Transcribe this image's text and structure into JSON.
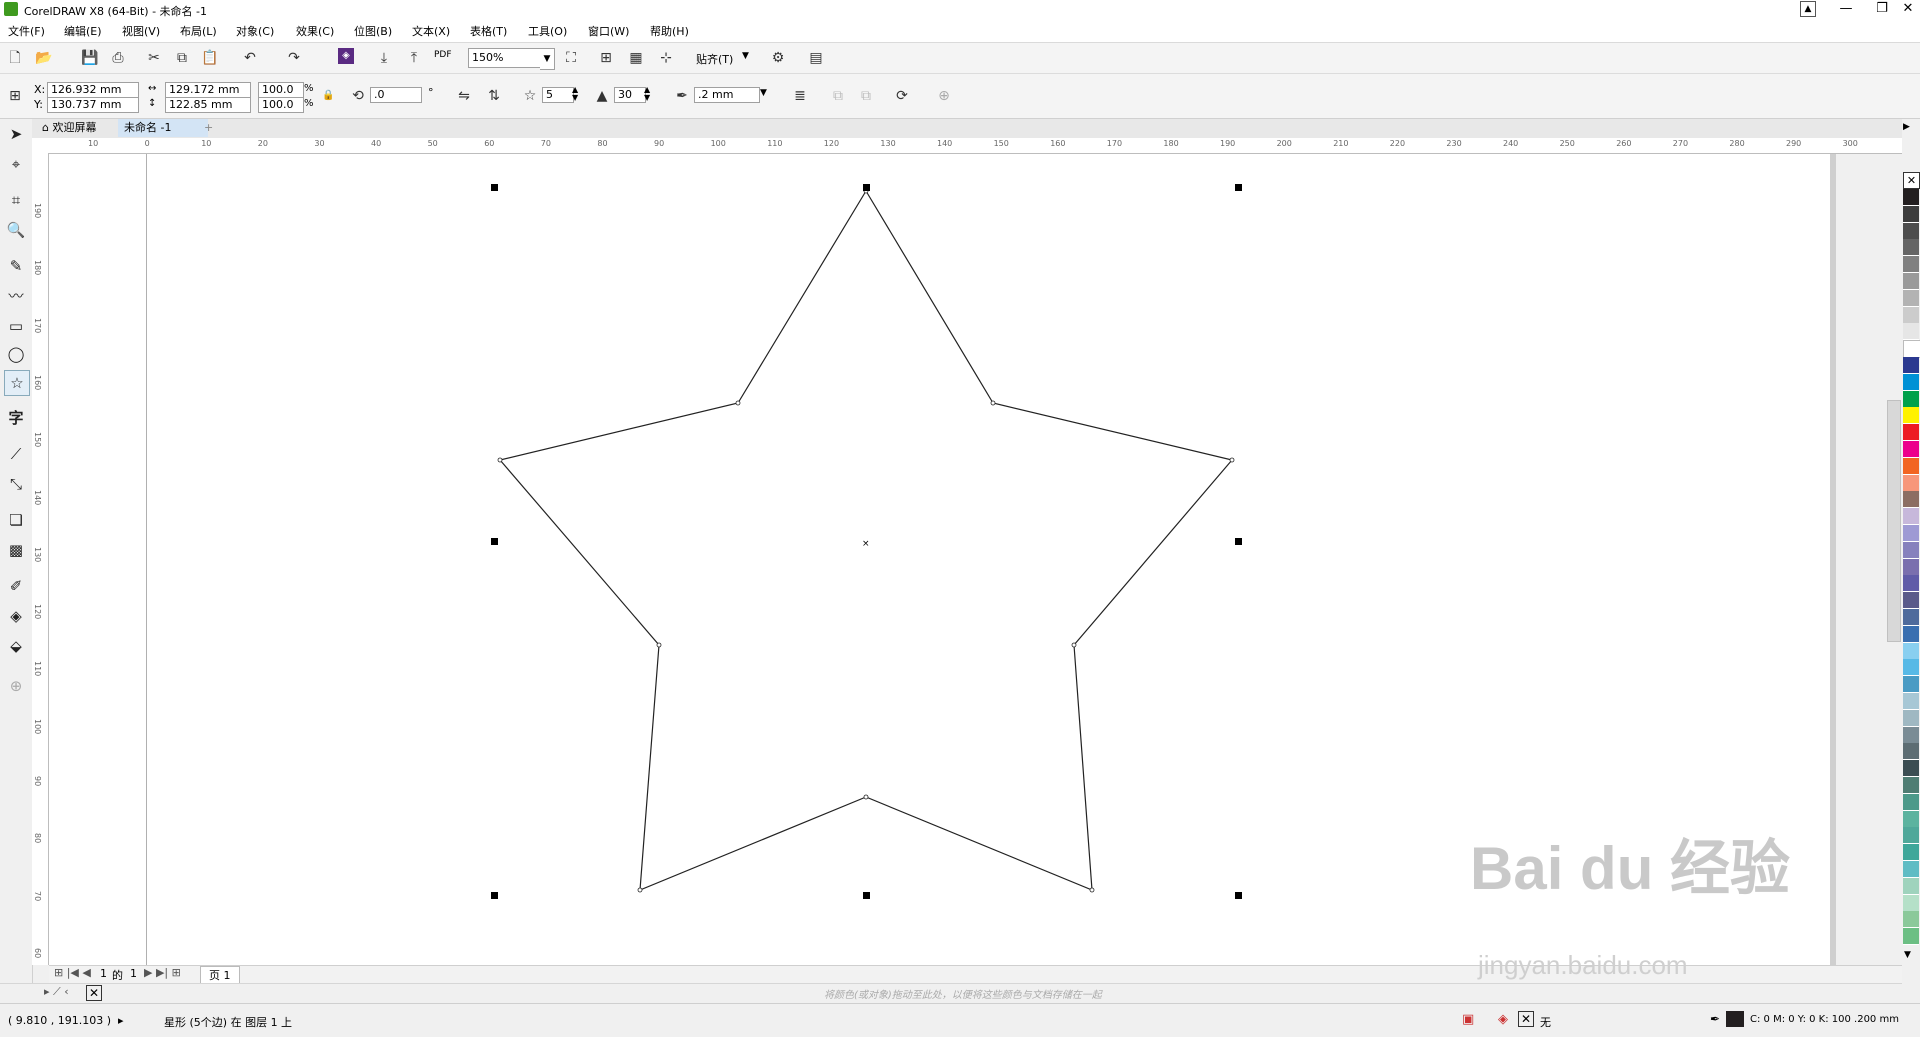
{
  "window": {
    "title": "CorelDRAW X8 (64-Bit) - 未命名 -1",
    "minimize": "—",
    "maximize": "❐",
    "close": "✕"
  },
  "menu": [
    "文件(F)",
    "编辑(E)",
    "视图(V)",
    "布局(L)",
    "对象(C)",
    "效果(C)",
    "位图(B)",
    "文本(X)",
    "表格(T)",
    "工具(O)",
    "窗口(W)",
    "帮助(H)"
  ],
  "toolbar": {
    "zoom": "150%",
    "snap_label": "贴齐(T)",
    "pdf_label": "PDF"
  },
  "props": {
    "x": "126.932 mm",
    "y": "130.737 mm",
    "width": "129.172 mm",
    "height": "122.85 mm",
    "scale_w": "100.0",
    "scale_h": "100.0",
    "percent": "%",
    "rotation": ".0",
    "degree": "°",
    "points": "5",
    "sharpness": "30",
    "outline": ".2 mm"
  },
  "tabs": {
    "welcome": "欢迎屏幕",
    "doc": "未命名 -1",
    "add": "+"
  },
  "ruler": {
    "h_labels": [
      "10",
      "0",
      "10",
      "20",
      "30",
      "40",
      "50",
      "60",
      "70",
      "80",
      "90",
      "100",
      "110",
      "120",
      "130",
      "140",
      "150",
      "160",
      "170",
      "180",
      "190",
      "200",
      "210",
      "220",
      "230",
      "240",
      "250",
      "260",
      "270",
      "280",
      "290",
      "300"
    ],
    "v_labels": [
      "190",
      "180",
      "170",
      "160",
      "150",
      "140",
      "130",
      "120",
      "110",
      "100",
      "90",
      "80",
      "70",
      "60"
    ]
  },
  "page_nav": {
    "current": "1",
    "of": "的",
    "total": "1",
    "page_tab": "页 1"
  },
  "color_hint": "将颜色(或对象)拖动至此处，以便将这些颜色与文档存储在一起",
  "status": {
    "coords": "( 9.810 , 191.103 )",
    "object_info": "星形 (5个边) 在 图层 1 上",
    "fill_label": "无",
    "outline_info": "C: 0 M: 0 Y: 0 K: 100  .200 mm"
  },
  "palette_colors": [
    "#231f20",
    "#3d3d3d",
    "#4d4d4d",
    "#656565",
    "#808080",
    "#9a9a9a",
    "#b3b3b3",
    "#cccccc",
    "#e6e6e6",
    "#ffffff",
    "#2b3990",
    "#0091d5",
    "#00a14b",
    "#fff200",
    "#ed1c24",
    "#ec008c",
    "#f26522",
    "#f7977a",
    "#8c6e63",
    "#c7b8db",
    "#9e9ad4",
    "#8781bd",
    "#7a6fae",
    "#605ca8",
    "#5a5a8a",
    "#4f6b9c",
    "#3a6fb0",
    "#89cff0",
    "#57b9e6",
    "#4a9bc4",
    "#a7c7d5",
    "#9fb8c2",
    "#7a8c95",
    "#5d6d73",
    "#3b4d52",
    "#4f7d73",
    "#4d9a8a",
    "#5cb39f",
    "#50a89a",
    "#3fa79a",
    "#5fbcc4",
    "#9fd3bd",
    "#b5e0c8",
    "#8bc99a",
    "#6cbf84"
  ],
  "watermark": {
    "brand": "Bai du 经验",
    "url": "jingyan.baidu.com"
  }
}
